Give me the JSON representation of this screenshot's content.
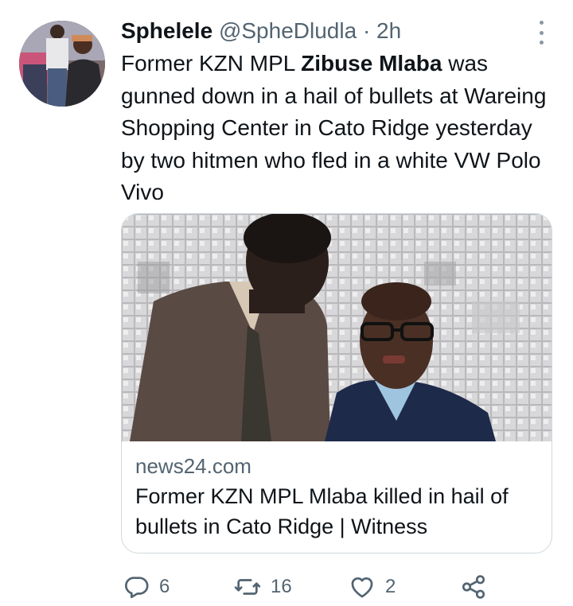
{
  "tweet": {
    "author_name": "Sphelele",
    "handle": "@SpheDludla",
    "separator": "·",
    "time": "2h",
    "text_before": "Former KZN MPL ",
    "text_bold": "Zibuse Mlaba",
    "text_after": " was gunned down in a hail of bullets at Wareing Shopping Center in Cato Ridge yesterday by two hitmen who fled in a white VW Polo Vivo"
  },
  "card": {
    "domain": "news24.com",
    "title": "Former KZN MPL Mlaba killed in hail of bullets in Cato Ridge | Witness"
  },
  "actions": {
    "reply_count": "6",
    "retweet_count": "16",
    "like_count": "2"
  },
  "icons": [
    "more-icon",
    "reply-icon",
    "retweet-icon",
    "like-icon",
    "share-icon"
  ],
  "colors": {
    "text": "#0f1419",
    "secondary": "#536471",
    "border": "#cfd9de"
  }
}
